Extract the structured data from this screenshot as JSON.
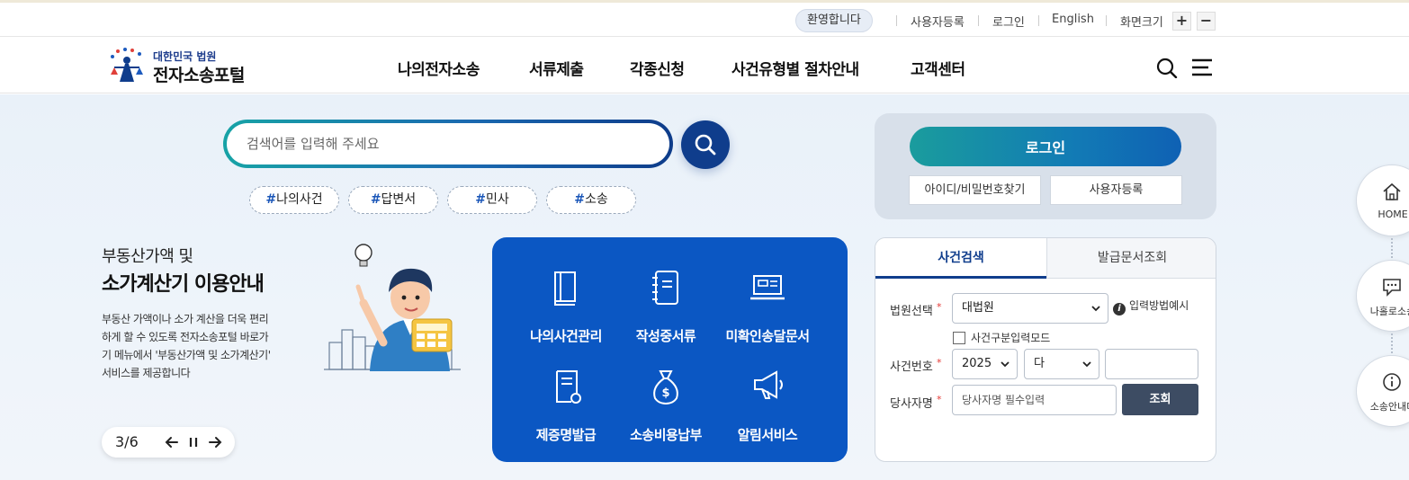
{
  "utility": {
    "welcome": "환영합니다",
    "register": "사용자등록",
    "login": "로그인",
    "english": "English",
    "zoom_label": "화면크기",
    "zoom_in": "+",
    "zoom_out": "−"
  },
  "header": {
    "logo_sub": "대한민국 법원",
    "logo_main": "전자소송포털",
    "nav": [
      "나의전자소송",
      "서류제출",
      "각종신청",
      "사건유형별 절차안내",
      "고객센터"
    ],
    "icons": [
      "search-icon",
      "menu-icon"
    ]
  },
  "search": {
    "placeholder": "검색어를 입력해 주세요",
    "tags": [
      {
        "hash": "#",
        "label": "나의사건"
      },
      {
        "hash": "#",
        "label": "답변서"
      },
      {
        "hash": "#",
        "label": "민사"
      },
      {
        "hash": "#",
        "label": "소송"
      }
    ]
  },
  "banner": {
    "title_line1": "부동산가액 및",
    "title_line2": "소가계산기 이용안내",
    "description": "부동산 가액이나 소가 계산을 더욱 편리하게 할 수 있도록 전자소송포털 바로가기 메뉴에서 '부동산가액 및 소가계산기' 서비스를 제공합니다",
    "slide_count": "3/6"
  },
  "quick_menu": [
    {
      "label": "나의사건관리",
      "icon": "book-icon"
    },
    {
      "label": "작성중서류",
      "icon": "notebook-icon"
    },
    {
      "label": "미확인송달문서",
      "icon": "laptop-icon"
    },
    {
      "label": "제증명발급",
      "icon": "certificate-icon"
    },
    {
      "label": "소송비용납부",
      "icon": "money-bag-icon"
    },
    {
      "label": "알림서비스",
      "icon": "megaphone-icon"
    }
  ],
  "login_box": {
    "login_label": "로그인",
    "find_label": "아이디/비밀번호찾기",
    "register_label": "사용자등록"
  },
  "case_search": {
    "tabs": [
      "사건검색",
      "발급문서조회"
    ],
    "court_label": "법원선택",
    "court_value": "대법원",
    "help_label": "입력방법예시",
    "checkbox_label": "사건구분입력모드",
    "case_no_label": "사건번호",
    "year_value": "2025",
    "type_value": "다",
    "party_label": "당사자명",
    "party_placeholder": "당사자명 필수입력",
    "submit_label": "조회",
    "required_mark": "*"
  },
  "floating": [
    {
      "label": "HOME",
      "icon": "home-icon"
    },
    {
      "label": "나홀로소송",
      "icon": "chat-icon"
    },
    {
      "label": "소송안내미",
      "icon": "info-icon"
    }
  ],
  "colors": {
    "primary_navy": "#0f3d8c",
    "quick_blue": "#0b57c3",
    "teal": "#1a9c9d",
    "required_red": "#e53935",
    "search_button_dark": "#3d4c63"
  }
}
